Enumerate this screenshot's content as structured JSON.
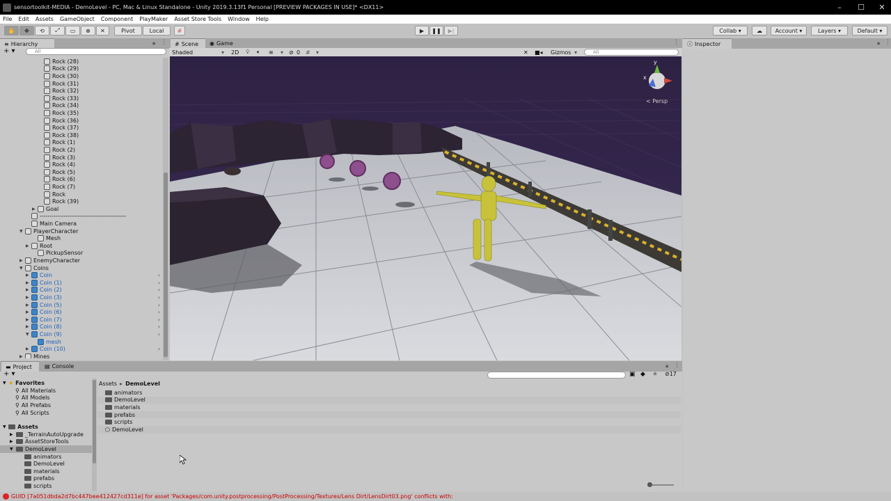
{
  "window": {
    "title": "sensortoolkit-MEDIA - DemoLevel - PC, Mac & Linux Standalone - Unity 2019.3.13f1 Personal [PREVIEW PACKAGES IN USE]* <DX11>",
    "controls": [
      "–",
      "☐",
      "✕"
    ]
  },
  "menu": [
    "File",
    "Edit",
    "Assets",
    "GameObject",
    "Component",
    "PlayMaker",
    "Asset Store Tools",
    "Window",
    "Help"
  ],
  "toolbar": {
    "pivot": "Pivot",
    "local": "Local",
    "collab": "Collab",
    "account": "Account",
    "layers": "Layers",
    "layout": "Default"
  },
  "hierarchy": {
    "tab": "Hierarchy",
    "search_placeholder": "All",
    "items": [
      {
        "label": "Rock (28)",
        "indent": 5,
        "arrow": "",
        "prefab": false,
        "blue": false,
        "chev": false
      },
      {
        "label": "Rock (29)",
        "indent": 5,
        "arrow": "",
        "prefab": false,
        "blue": false,
        "chev": false
      },
      {
        "label": "Rock (30)",
        "indent": 5,
        "arrow": "",
        "prefab": false,
        "blue": false,
        "chev": false
      },
      {
        "label": "Rock (31)",
        "indent": 5,
        "arrow": "",
        "prefab": false,
        "blue": false,
        "chev": false
      },
      {
        "label": "Rock (32)",
        "indent": 5,
        "arrow": "",
        "prefab": false,
        "blue": false,
        "chev": false
      },
      {
        "label": "Rock (33)",
        "indent": 5,
        "arrow": "",
        "prefab": false,
        "blue": false,
        "chev": false
      },
      {
        "label": "Rock (34)",
        "indent": 5,
        "arrow": "",
        "prefab": false,
        "blue": false,
        "chev": false
      },
      {
        "label": "Rock (35)",
        "indent": 5,
        "arrow": "",
        "prefab": false,
        "blue": false,
        "chev": false
      },
      {
        "label": "Rock (36)",
        "indent": 5,
        "arrow": "",
        "prefab": false,
        "blue": false,
        "chev": false
      },
      {
        "label": "Rock (37)",
        "indent": 5,
        "arrow": "",
        "prefab": false,
        "blue": false,
        "chev": false
      },
      {
        "label": "Rock (38)",
        "indent": 5,
        "arrow": "",
        "prefab": false,
        "blue": false,
        "chev": false
      },
      {
        "label": "Rock (1)",
        "indent": 5,
        "arrow": "",
        "prefab": false,
        "blue": false,
        "chev": false
      },
      {
        "label": "Rock (2)",
        "indent": 5,
        "arrow": "",
        "prefab": false,
        "blue": false,
        "chev": false
      },
      {
        "label": "Rock (3)",
        "indent": 5,
        "arrow": "",
        "prefab": false,
        "blue": false,
        "chev": false
      },
      {
        "label": "Rock (4)",
        "indent": 5,
        "arrow": "",
        "prefab": false,
        "blue": false,
        "chev": false
      },
      {
        "label": "Rock (5)",
        "indent": 5,
        "arrow": "",
        "prefab": false,
        "blue": false,
        "chev": false
      },
      {
        "label": "Rock (6)",
        "indent": 5,
        "arrow": "",
        "prefab": false,
        "blue": false,
        "chev": false
      },
      {
        "label": "Rock (7)",
        "indent": 5,
        "arrow": "",
        "prefab": false,
        "blue": false,
        "chev": false
      },
      {
        "label": "Rock",
        "indent": 5,
        "arrow": "",
        "prefab": false,
        "blue": false,
        "chev": false
      },
      {
        "label": "Rock (39)",
        "indent": 5,
        "arrow": "",
        "prefab": false,
        "blue": false,
        "chev": false
      },
      {
        "label": "Goal",
        "indent": 4,
        "arrow": "▶",
        "prefab": false,
        "blue": false,
        "chev": false
      },
      {
        "label": "-------------------------------------------",
        "indent": 3,
        "arrow": "",
        "prefab": false,
        "blue": false,
        "chev": false
      },
      {
        "label": "Main Camera",
        "indent": 3,
        "arrow": "",
        "prefab": false,
        "blue": false,
        "chev": false
      },
      {
        "label": "PlayerCharacter",
        "indent": 2,
        "arrow": "▼",
        "prefab": false,
        "blue": false,
        "chev": false
      },
      {
        "label": "Mesh",
        "indent": 4,
        "arrow": "",
        "prefab": false,
        "blue": false,
        "chev": false
      },
      {
        "label": "Root",
        "indent": 3,
        "arrow": "▶",
        "prefab": false,
        "blue": false,
        "chev": false
      },
      {
        "label": "PickupSensor",
        "indent": 4,
        "arrow": "",
        "prefab": false,
        "blue": false,
        "chev": false
      },
      {
        "label": "EnemyCharacter",
        "indent": 2,
        "arrow": "▶",
        "prefab": false,
        "blue": false,
        "chev": false
      },
      {
        "label": "Coins",
        "indent": 2,
        "arrow": "▼",
        "prefab": false,
        "blue": false,
        "chev": false
      },
      {
        "label": "Coin",
        "indent": 3,
        "arrow": "▶",
        "prefab": true,
        "blue": true,
        "chev": true
      },
      {
        "label": "Coin (1)",
        "indent": 3,
        "arrow": "▶",
        "prefab": true,
        "blue": true,
        "chev": true
      },
      {
        "label": "Coin (2)",
        "indent": 3,
        "arrow": "▶",
        "prefab": true,
        "blue": true,
        "chev": true
      },
      {
        "label": "Coin (3)",
        "indent": 3,
        "arrow": "▶",
        "prefab": true,
        "blue": true,
        "chev": true
      },
      {
        "label": "Coin (5)",
        "indent": 3,
        "arrow": "▶",
        "prefab": true,
        "blue": true,
        "chev": true
      },
      {
        "label": "Coin (6)",
        "indent": 3,
        "arrow": "▶",
        "prefab": true,
        "blue": true,
        "chev": true
      },
      {
        "label": "Coin (7)",
        "indent": 3,
        "arrow": "▶",
        "prefab": true,
        "blue": true,
        "chev": true
      },
      {
        "label": "Coin (8)",
        "indent": 3,
        "arrow": "▶",
        "prefab": true,
        "blue": true,
        "chev": true
      },
      {
        "label": "Coin (9)",
        "indent": 3,
        "arrow": "▼",
        "prefab": true,
        "blue": true,
        "chev": true
      },
      {
        "label": "mesh",
        "indent": 4,
        "arrow": "",
        "prefab": true,
        "blue": true,
        "chev": false
      },
      {
        "label": "Coin (10)",
        "indent": 3,
        "arrow": "▶",
        "prefab": true,
        "blue": true,
        "chev": true
      },
      {
        "label": "Mines",
        "indent": 2,
        "arrow": "▶",
        "prefab": false,
        "blue": false,
        "chev": false
      }
    ]
  },
  "scene": {
    "tabs": [
      "Scene",
      "Game"
    ],
    "shading": "Shaded",
    "mode_2d": "2D",
    "hidden_count": "0",
    "gizmos": "Gizmos",
    "search_placeholder": "All",
    "persp": "< Persp",
    "axis_y": "y",
    "axis_x": "x"
  },
  "inspector": {
    "tab": "Inspector"
  },
  "project": {
    "tabs": [
      "Project",
      "Console"
    ],
    "favorites_title": "Favorites",
    "favorites": [
      "All Materials",
      "All Models",
      "All Prefabs",
      "All Scripts"
    ],
    "assets_title": "Assets",
    "tree": [
      {
        "label": "_TerrainAutoUpgrade",
        "indent": 1,
        "arrow": "▶"
      },
      {
        "label": "AssetStoreTools",
        "indent": 1,
        "arrow": "▶"
      },
      {
        "label": "DemoLevel",
        "indent": 1,
        "arrow": "▼"
      },
      {
        "label": "animators",
        "indent": 2,
        "arrow": ""
      },
      {
        "label": "DemoLevel",
        "indent": 2,
        "arrow": ""
      },
      {
        "label": "materials",
        "indent": 2,
        "arrow": ""
      },
      {
        "label": "prefabs",
        "indent": 2,
        "arrow": ""
      },
      {
        "label": "scripts",
        "indent": 2,
        "arrow": ""
      }
    ],
    "breadcrumb": [
      "Assets",
      "DemoLevel"
    ],
    "files": [
      "animators",
      "DemoLevel",
      "materials",
      "prefabs",
      "scripts",
      "DemoLevel"
    ],
    "count_badge": "17"
  },
  "status": {
    "message": "GUID [7a051dbda2d7bc447bee412427cd311e] for asset 'Packages/com.unity.postprocessing/PostProcessing/Textures/Lens Dirt/LensDirt03.png' conflicts with:"
  },
  "colors": {
    "sky": "#2b1f3f",
    "floor": "#c9cbd0",
    "character": "#c8c23a",
    "coin": "#8e4f8e",
    "link_blue": "#1f5fb6",
    "error": "#c00000"
  }
}
